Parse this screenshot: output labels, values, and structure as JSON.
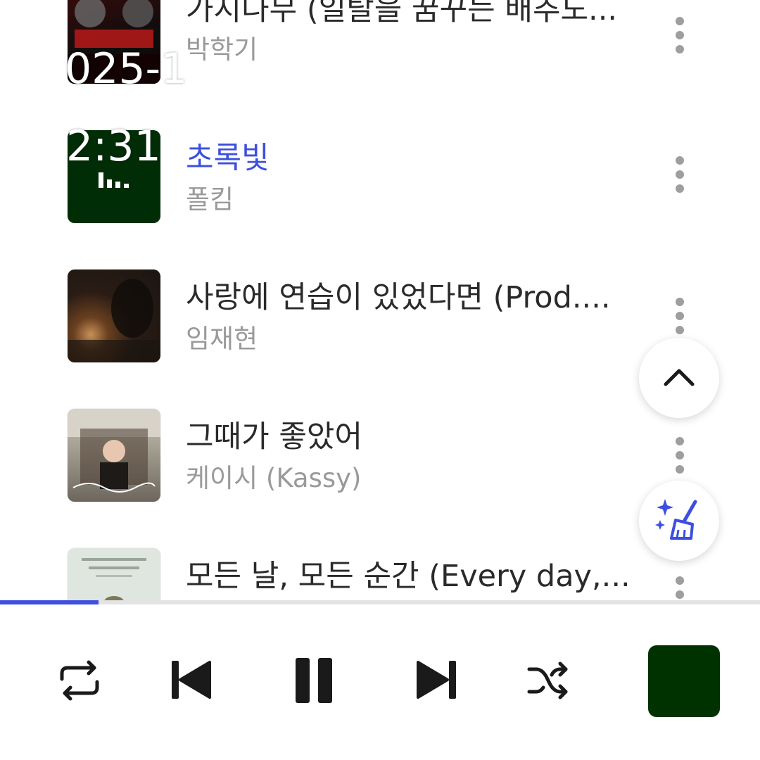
{
  "overlay": {
    "date_fragment": "025-1",
    "time_fragment": "2:31"
  },
  "tracks": [
    {
      "title": "가시나무 (일탈을 꿈꾸는 배추도...",
      "artist": "박학기",
      "active": false,
      "art_icon": "album-art-gasinamu"
    },
    {
      "title": "초록빛",
      "artist": "폴킴",
      "active": true,
      "art_icon": "album-art-chorokbit"
    },
    {
      "title": "사랑에 연습이 있었다면 (Prod....",
      "artist": "임재현",
      "active": false,
      "art_icon": "album-art-sarang"
    },
    {
      "title": "그때가 좋았어",
      "artist": "케이시 (Kassy)",
      "active": false,
      "art_icon": "album-art-geuttae"
    },
    {
      "title": "모든 날, 모든 순간 (Every day,...",
      "artist": "",
      "active": false,
      "art_icon": "album-art-modeun-nal"
    }
  ],
  "progress": {
    "fraction": 0.13
  },
  "colors": {
    "accent": "#3d4fe0",
    "now_playing_art": "#003200"
  },
  "controls": [
    "repeat-icon",
    "previous-icon",
    "pause-icon",
    "next-icon",
    "shuffle-icon"
  ],
  "fabs": [
    "chevron-up-icon",
    "sparkle-broom-icon"
  ]
}
